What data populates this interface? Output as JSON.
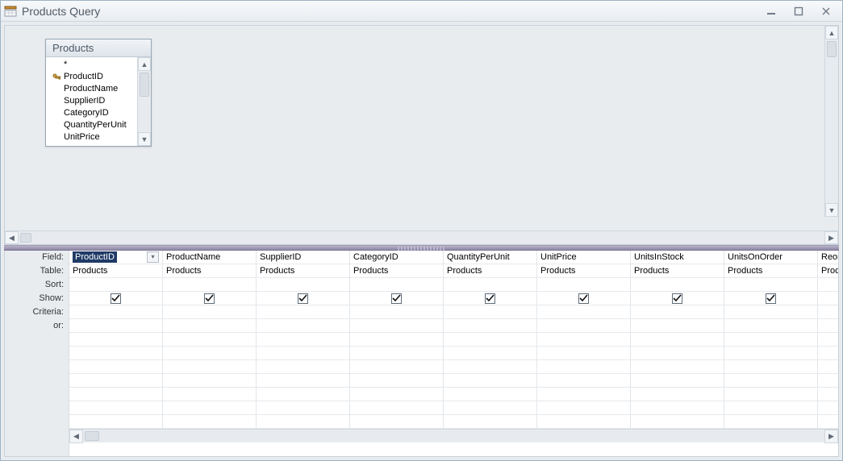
{
  "window": {
    "title": "Products Query"
  },
  "table_card": {
    "name": "Products",
    "fields": [
      "*",
      "ProductID",
      "ProductName",
      "SupplierID",
      "CategoryID",
      "QuantityPerUnit",
      "UnitPrice"
    ],
    "primary_key_field": "ProductID"
  },
  "grid": {
    "row_labels": [
      "Field:",
      "Table:",
      "Sort:",
      "Show:",
      "Criteria:",
      "or:"
    ],
    "columns": [
      {
        "field": "ProductID",
        "table": "Products",
        "sort": "",
        "show": true,
        "criteria": "",
        "or": "",
        "selected": true
      },
      {
        "field": "ProductName",
        "table": "Products",
        "sort": "",
        "show": true,
        "criteria": "",
        "or": ""
      },
      {
        "field": "SupplierID",
        "table": "Products",
        "sort": "",
        "show": true,
        "criteria": "",
        "or": ""
      },
      {
        "field": "CategoryID",
        "table": "Products",
        "sort": "",
        "show": true,
        "criteria": "",
        "or": ""
      },
      {
        "field": "QuantityPerUnit",
        "table": "Products",
        "sort": "",
        "show": true,
        "criteria": "",
        "or": ""
      },
      {
        "field": "UnitPrice",
        "table": "Products",
        "sort": "",
        "show": true,
        "criteria": "",
        "or": ""
      },
      {
        "field": "UnitsInStock",
        "table": "Products",
        "sort": "",
        "show": true,
        "criteria": "",
        "or": ""
      },
      {
        "field": "UnitsOnOrder",
        "table": "Products",
        "sort": "",
        "show": true,
        "criteria": "",
        "or": ""
      },
      {
        "field": "ReorderLevel",
        "table": "Products",
        "sort": "",
        "show": true,
        "criteria": "",
        "or": ""
      }
    ],
    "blank_extra_rows": 7
  }
}
